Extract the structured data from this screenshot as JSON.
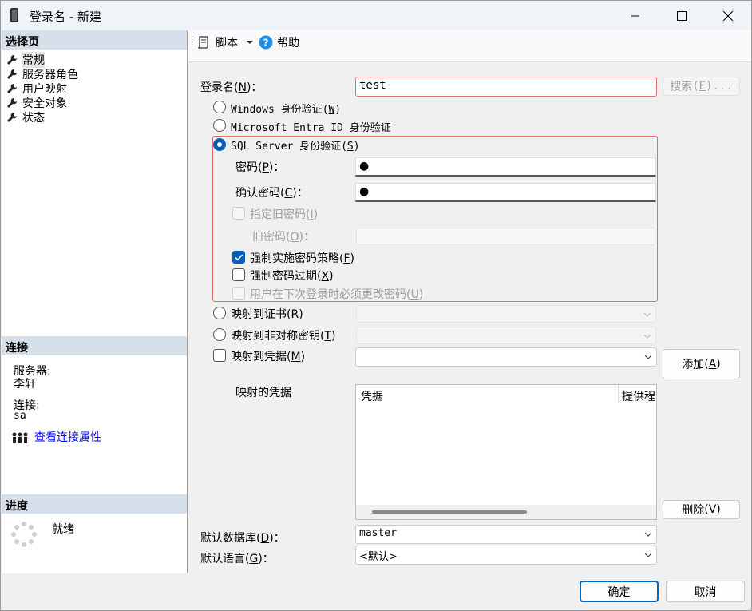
{
  "window": {
    "title": "登录名 - 新建"
  },
  "left": {
    "select_page_header": "选择页",
    "pages": [
      {
        "label": "常规"
      },
      {
        "label": "服务器角色"
      },
      {
        "label": "用户映射"
      },
      {
        "label": "安全对象"
      },
      {
        "label": "状态"
      }
    ],
    "connection_header": "连接",
    "server_label": "服务器:",
    "server_value": "李轩",
    "connection_label": "连接:",
    "connection_value": "sa",
    "view_props_link": "查看连接属性",
    "progress_header": "进度",
    "progress_status": "就绪"
  },
  "toolbar": {
    "script_label": "脚本",
    "help_label": "帮助"
  },
  "form": {
    "login_name_label": "登录名",
    "login_name_key": "N",
    "login_name_value": "test",
    "search_label": "搜索",
    "search_key": "E",
    "windows_auth_label": "Windows 身份验证",
    "windows_auth_key": "W",
    "entra_auth_label": "Microsoft Entra ID 身份验证",
    "sql_auth_label": "SQL Server 身份验证",
    "sql_auth_key": "S",
    "password_label": "密码",
    "password_key": "P",
    "password_value": "●",
    "confirm_label": "确认密码",
    "confirm_key": "C",
    "confirm_value": "●",
    "old_pwd_check_label": "指定旧密码",
    "old_pwd_check_key": "I",
    "old_pwd_label": "旧密码",
    "old_pwd_key": "O",
    "enforce_policy_label": "强制实施密码策略",
    "enforce_policy_key": "F",
    "enforce_expiry_label": "强制密码过期",
    "enforce_expiry_key": "X",
    "must_change_label": "用户在下次登录时必须更改密码",
    "must_change_key": "U",
    "map_cert_label": "映射到证书",
    "map_cert_key": "R",
    "map_asym_label": "映射到非对称密钥",
    "map_asym_key": "T",
    "map_cred_label": "映射到凭据",
    "map_cred_key": "M",
    "add_label": "添加",
    "add_key": "A",
    "mapped_creds_label": "映射的凭据",
    "cred_col": "凭据",
    "provider_col": "提供程",
    "remove_label": "删除",
    "remove_key": "V",
    "default_db_label": "默认数据库",
    "default_db_key": "D",
    "default_db_value": "master",
    "default_lang_label": "默认语言",
    "default_lang_key": "G",
    "default_lang_value": "<默认>"
  },
  "footer": {
    "ok_label": "确定",
    "cancel_label": "取消"
  },
  "colors": {
    "accent": "#005fb8",
    "error_border": "#e07070",
    "header_bg": "#d5dfea"
  }
}
